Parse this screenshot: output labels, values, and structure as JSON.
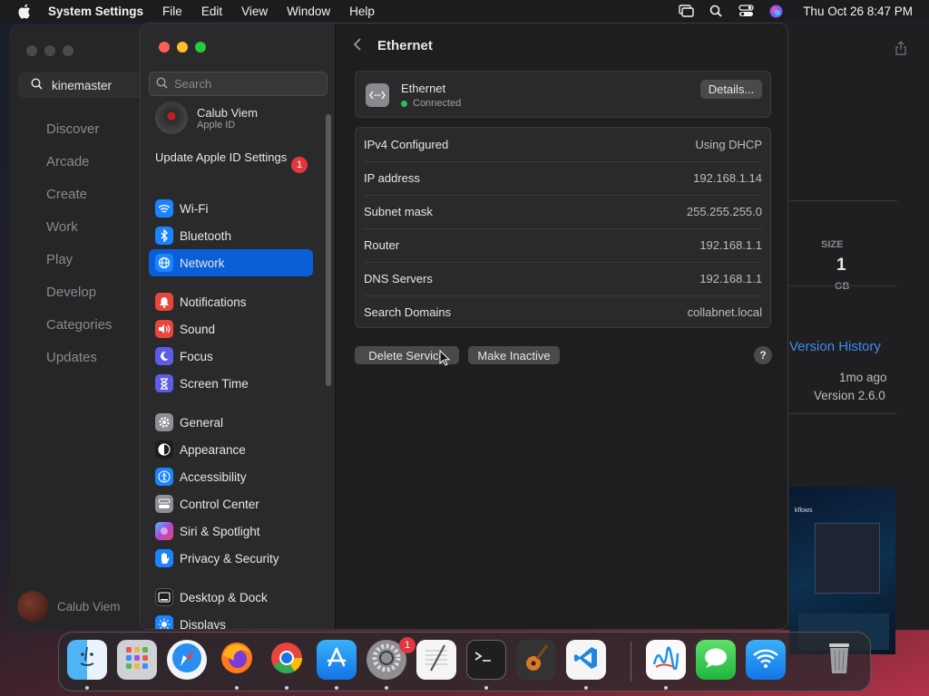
{
  "menubar": {
    "app_name": "System Settings",
    "menus": [
      "File",
      "Edit",
      "View",
      "Window",
      "Help"
    ],
    "clock": "Thu Oct 26  8:47 PM"
  },
  "appstore": {
    "search_value": "kinemaster",
    "nav": [
      "Discover",
      "Arcade",
      "Create",
      "Work",
      "Play",
      "Develop",
      "Categories",
      "Updates"
    ],
    "user_name": "Calub Viem",
    "size_label": "SIZE",
    "size_value": "1",
    "size_unit": "GB",
    "version_history": "Version History",
    "updated_ago": "1mo ago",
    "version": "Version 2.6.0",
    "screenshot_caption": "kflows"
  },
  "settings": {
    "search_placeholder": "Search",
    "account": {
      "name": "Calub Viem",
      "subtitle": "Apple ID"
    },
    "update_apple_id": "Update Apple ID Settings",
    "update_badge": "1",
    "sidebar": [
      {
        "label": "Wi-Fi",
        "icon": "wifi-icon",
        "color": "#1a84ff",
        "active": false
      },
      {
        "label": "Bluetooth",
        "icon": "bluetooth-icon",
        "color": "#1a84ff",
        "active": false
      },
      {
        "label": "Network",
        "icon": "network-globe-icon",
        "color": "#1a84ff",
        "active": true
      },
      {
        "label": "Notifications",
        "icon": "bell-icon",
        "color": "#e8453c",
        "active": false
      },
      {
        "label": "Sound",
        "icon": "speaker-icon",
        "color": "#e8453c",
        "active": false
      },
      {
        "label": "Focus",
        "icon": "moon-icon",
        "color": "#5e5ce6",
        "active": false
      },
      {
        "label": "Screen Time",
        "icon": "hourglass-icon",
        "color": "#5e5ce6",
        "active": false
      },
      {
        "label": "General",
        "icon": "gear-icon",
        "color": "#8e8e93",
        "active": false
      },
      {
        "label": "Appearance",
        "icon": "appearance-icon",
        "color": "#1c1c1e",
        "active": false
      },
      {
        "label": "Accessibility",
        "icon": "accessibility-icon",
        "color": "#1a84ff",
        "active": false
      },
      {
        "label": "Control Center",
        "icon": "control-center-icon",
        "color": "#8e8e93",
        "active": false
      },
      {
        "label": "Siri & Spotlight",
        "icon": "siri-icon",
        "color": "#b445d8",
        "active": false
      },
      {
        "label": "Privacy & Security",
        "icon": "hand-icon",
        "color": "#1a84ff",
        "active": false
      },
      {
        "label": "Desktop & Dock",
        "icon": "dock-icon",
        "color": "#1c1c1e",
        "active": false
      },
      {
        "label": "Displays",
        "icon": "sun-icon",
        "color": "#1a84ff",
        "active": false
      }
    ],
    "main": {
      "title": "Ethernet",
      "interface_name": "Ethernet",
      "interface_status": "Connected",
      "details_label": "Details...",
      "rows": [
        {
          "key": "IPv4 Configured",
          "value": "Using DHCP"
        },
        {
          "key": "IP address",
          "value": "192.168.1.14"
        },
        {
          "key": "Subnet mask",
          "value": "255.255.255.0"
        },
        {
          "key": "Router",
          "value": "192.168.1.1"
        },
        {
          "key": "DNS Servers",
          "value": "192.168.1.1"
        },
        {
          "key": "Search Domains",
          "value": "collabnet.local"
        }
      ],
      "delete_label": "Delete Service",
      "inactive_label": "Make Inactive",
      "help_label": "?"
    }
  },
  "dock": {
    "apps": [
      "Finder",
      "Launchpad",
      "Safari",
      "Firefox",
      "Chrome",
      "App Store",
      "System Settings",
      "TextEdit",
      "Terminal",
      "GarageBand",
      "Visual Studio Code",
      "Freeform",
      "Messages",
      "Wireless Diagnostics",
      "Trash"
    ],
    "settings_badge": "1"
  }
}
